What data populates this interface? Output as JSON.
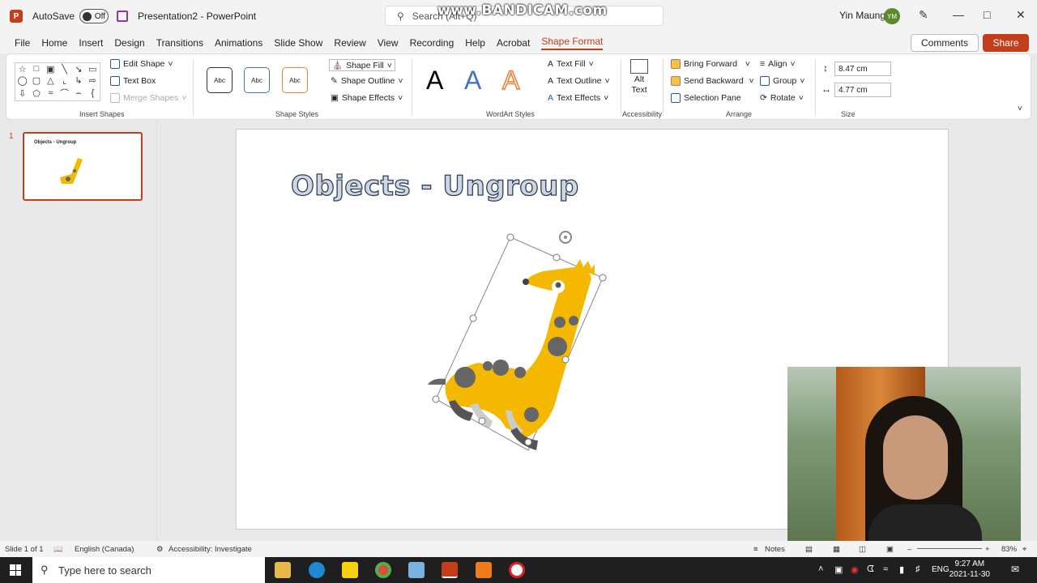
{
  "titlebar": {
    "autosave_label": "AutoSave",
    "autosave_state": "Off",
    "doc_title": "Presentation2  -  PowerPoint",
    "search_placeholder": "Search (Alt+Q)",
    "watermark": "www.BANDICAM.com",
    "user_name": "Yin Maung",
    "user_initials": "YM"
  },
  "menu": {
    "items": [
      "File",
      "Home",
      "Insert",
      "Design",
      "Transitions",
      "Animations",
      "Slide Show",
      "Review",
      "View",
      "Recording",
      "Help",
      "Acrobat",
      "Shape Format"
    ],
    "active": "Shape Format",
    "comments": "Comments",
    "share": "Share"
  },
  "ribbon": {
    "insert_shapes": {
      "edit_shape": "Edit Shape",
      "text_box": "Text Box",
      "merge_shapes": "Merge Shapes",
      "label": "Insert Shapes"
    },
    "shape_styles": {
      "sample": "Abc",
      "shape_fill": "Shape Fill",
      "shape_outline": "Shape Outline",
      "shape_effects": "Shape Effects",
      "label": "Shape Styles"
    },
    "wordart": {
      "letter": "A",
      "text_fill": "Text Fill",
      "text_outline": "Text Outline",
      "text_effects": "Text Effects",
      "label": "WordArt Styles"
    },
    "accessibility": {
      "alt_text_1": "Alt",
      "alt_text_2": "Text",
      "label": "Accessibility"
    },
    "arrange": {
      "bring_forward": "Bring Forward",
      "send_backward": "Send Backward",
      "selection_pane": "Selection Pane",
      "align": "Align",
      "group": "Group",
      "rotate": "Rotate",
      "label": "Arrange"
    },
    "size": {
      "height": "8.47 cm",
      "width": "4.77 cm",
      "label": "Size"
    }
  },
  "slides_pane": {
    "number": "1",
    "thumb_title": "Objects - Ungroup"
  },
  "slide": {
    "title": "Objects - Ungroup"
  },
  "status": {
    "slide_info": "Slide 1 of 1",
    "language": "English (Canada)",
    "accessibility": "Accessibility: Investigate",
    "notes": "Notes",
    "zoom": "83%"
  },
  "taskbar": {
    "search_placeholder": "Type here to search",
    "language": "ENG",
    "time": "9:27 AM",
    "date": "2021-11-30"
  },
  "colors": {
    "accent": "#c43e1c",
    "giraffe_body": "#f5b800",
    "giraffe_spots": "#666666"
  }
}
